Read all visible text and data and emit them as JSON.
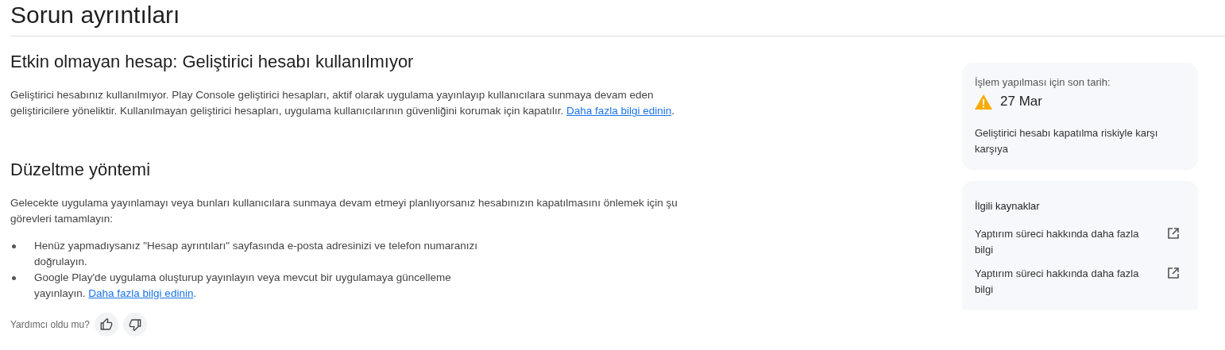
{
  "page_title": "Sorun ayrıntıları",
  "issue": {
    "title": "Etkin olmayan hesap: Geliştirici hesabı kullanılmıyor",
    "text": "Geliştirici hesabınız kullanılmıyor. Play Console geliştirici hesapları, aktif olarak uygulama yayınlayıp kullanıcılara sunmaya devam eden geliştiricilere yöneliktir. Kullanılmayan geliştirici hesapları, uygulama kullanıcılarının güvenliğini korumak için kapatılır.",
    "link": "Daha fazla bilgi edinin",
    "after_link": "."
  },
  "fix": {
    "title": "Düzeltme yöntemi",
    "text": "Gelecekte uygulama yayınlamayı veya bunları kullanıcılara sunmaya devam etmeyi planlıyorsanız hesabınızın kapatılmasını önlemek için şu görevleri tamamlayın:",
    "steps": [
      {
        "text": "Henüz yapmadıysanız \"Hesap ayrıntıları\" sayfasında e-posta adresinizi ve telefon numaranızı doğrulayın."
      },
      {
        "text": "Google Play'de uygulama oluşturup yayınlayın veya mevcut bir uygulamaya güncelleme yayınlayın.",
        "link": "Daha fazla bilgi edinin",
        "after_link": "."
      }
    ]
  },
  "feedback": {
    "question": "Yardımcı oldu mu?"
  },
  "deadline": {
    "label": "İşlem yapılması için son tarih:",
    "date": "27 Mar",
    "note": "Geliştirici hesabı kapatılma riskiyle karşı karşıya"
  },
  "resources": {
    "title": "İlgili kaynaklar",
    "links": [
      {
        "text": "Yaptırım süreci hakkında daha fazla bilgi"
      },
      {
        "text": "Yaptırım süreci hakkında daha fazla bilgi"
      }
    ]
  }
}
